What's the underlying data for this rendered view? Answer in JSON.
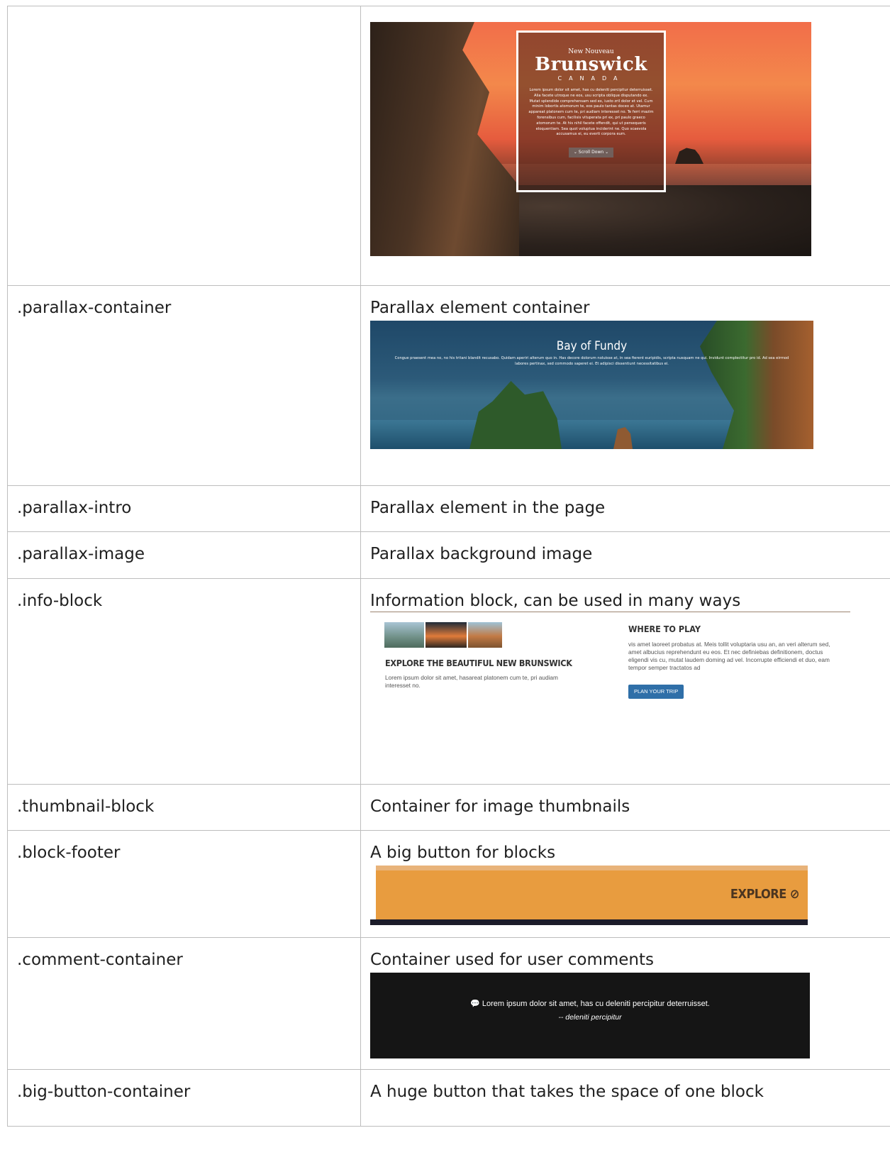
{
  "rows": [
    {
      "cls": "",
      "desc": ""
    },
    {
      "cls": ".parallax-container",
      "desc": "Parallax element container"
    },
    {
      "cls": ".parallax-intro",
      "desc": "Parallax element in the page"
    },
    {
      "cls": ".parallax-image",
      "desc": "Parallax background image"
    },
    {
      "cls": ".info-block",
      "desc": "Information block, can be used in many ways"
    },
    {
      "cls": ".thumbnail-block",
      "desc": "Container for image thumbnails"
    },
    {
      "cls": ".block-footer",
      "desc": "A big button for blocks"
    },
    {
      "cls": ".comment-container",
      "desc": "Container used for user comments"
    },
    {
      "cls": ".big-button-container",
      "desc": "A huge button that takes the space of one block"
    }
  ],
  "nb_screenshot": {
    "logo_new": "New",
    "logo_nouveau": "Nouveau",
    "logo_main": "Brunswick",
    "logo_canada": "CANADA",
    "lorem": "Lorem ipsum dolor sit amet, has cu deleniti percipitur deterruisset. Alia facete utroque ne eos, usu scripta oblique disputando ex. Mutat splendide comprehensam sed ex, iusto zril dolor et vel. Cum minim lobortis atomorum te, eos paulo tantas doceo at. Utamur appareat platonem cum te, pri audiam interesset no. Te ferri mazim forensibus cum, facilisis vituperata pri ex, pri paulo graeco atomorum te. At his nihil facete offendit, qui ut persequeris eloquentiam. Sea quot voluptua inciderint ne. Quo scaevola accusamus ei, eu everti corpora eum.",
    "scroll_label": "⌄ Scroll Down ⌄"
  },
  "bay_screenshot": {
    "title": "Bay of Fundy",
    "text": "Congue praesent mea no, no his tritani blandit recusabo. Quidam aperiri alterum quo in. Has decore dolorum noluisse at, in sea fierent euripidis, scripta nusquam ne qui. Invidunt complectitur pro id. Ad sea eirmod labores pertinax, sed commodo saperet ei. Et adipisci dissentiunt necessitatibus ei."
  },
  "info_screenshot": {
    "left_heading": "EXPLORE THE BEAUTIFUL NEW BRUNSWICK",
    "left_text": "Lorem ipsum dolor sit amet, hasareat platonem cum te, pri audiam interesset no.",
    "right_heading": "WHERE TO PLAY",
    "right_text": "vis amet laoreet probatus at. Meis tollit voluptaria usu an, an veri alterum sed, amet albucius reprehendunt eu eos. Et nec definiebas definitionem, doctus eligendi vis cu, mutat laudem doming ad vel. Incorrupte efficiendi et duo, eam tempor semper tractatos ad",
    "button_label": "PLAN YOUR TRIP"
  },
  "footer_screenshot": {
    "label": "EXPLORE ⊘"
  },
  "comment_screenshot": {
    "quote": "💬 Lorem ipsum dolor sit amet, has cu deleniti percipitur deterruisset.",
    "author": "-- deleniti percipitur"
  }
}
